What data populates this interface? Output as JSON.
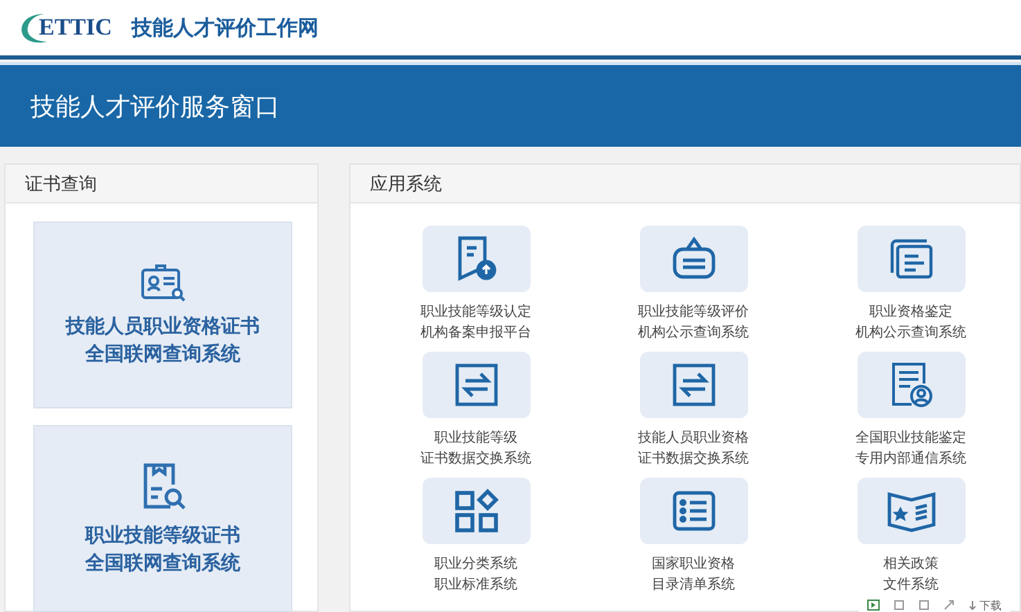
{
  "header": {
    "logo": "ETTIC",
    "site_title": "技能人才评价工作网"
  },
  "banner": {
    "title": "技能人才评价服务窗口"
  },
  "certificate_panel": {
    "title": "证书查询",
    "cards": [
      {
        "kind": "certificate",
        "lines": [
          "技能人员职业资格证书",
          "全国联网查询系统"
        ]
      },
      {
        "kind": "document",
        "lines": [
          "职业技能等级证书",
          "全国联网查询系统"
        ]
      }
    ]
  },
  "apps_panel": {
    "title": "应用系统",
    "items": [
      {
        "kind": "upload",
        "lines": [
          "职业技能等级认定",
          "机构备案申报平台"
        ]
      },
      {
        "kind": "sign",
        "lines": [
          "职业技能等级评价",
          "机构公示查询系统"
        ]
      },
      {
        "kind": "cards",
        "lines": [
          "职业资格鉴定",
          "机构公示查询系统"
        ]
      },
      {
        "kind": "exchange",
        "lines": [
          "职业技能等级",
          "证书数据交换系统"
        ]
      },
      {
        "kind": "exchange",
        "lines": [
          "技能人员职业资格",
          "证书数据交换系统"
        ]
      },
      {
        "kind": "profile",
        "lines": [
          "全国职业技能鉴定",
          "专用内部通信系统"
        ]
      },
      {
        "kind": "grid",
        "lines": [
          "职业分类系统",
          "职业标准系统"
        ]
      },
      {
        "kind": "list",
        "lines": [
          "国家职业资格",
          "目录清单系统"
        ]
      },
      {
        "kind": "book",
        "lines": [
          "相关政策",
          "文件系统"
        ]
      }
    ]
  },
  "toolbar": {
    "download": "下载"
  }
}
